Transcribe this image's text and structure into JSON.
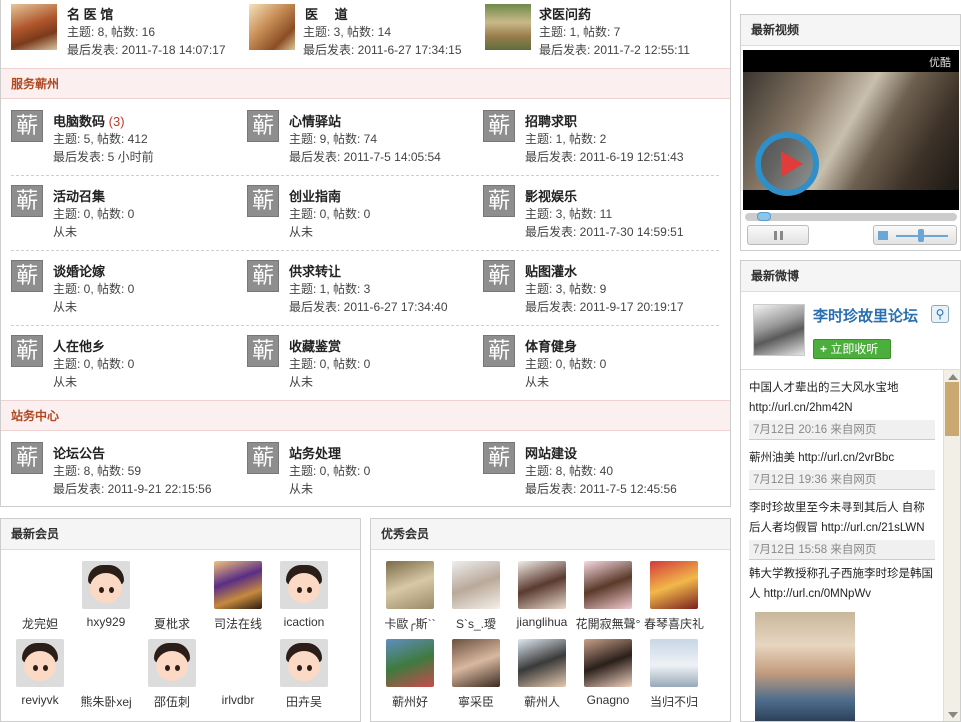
{
  "forums_top": [
    {
      "name": "名 医 馆",
      "stats": "主题: 8, 帖数: 16",
      "last": "最后发表: 2011-7-18 14:07:17"
    },
    {
      "name": "医　 道",
      "stats": "主题: 3, 帖数: 14",
      "last": "最后发表: 2011-6-27 17:34:15"
    },
    {
      "name": "求医问药",
      "stats": "主题: 1, 帖数: 7",
      "last": "最后发表: 2011-7-2 12:55:11"
    }
  ],
  "section1": {
    "title": "服务蕲州"
  },
  "forums_service": [
    {
      "name": "电脑数码",
      "today": "(3)",
      "stats": "主题: 5, 帖数: 412",
      "last": "最后发表: 5 小时前"
    },
    {
      "name": "心情驿站",
      "today": "",
      "stats": "主题: 9, 帖数: 74",
      "last": "最后发表: 2011-7-5 14:05:54"
    },
    {
      "name": "招聘求职",
      "today": "",
      "stats": "主题: 1, 帖数: 2",
      "last": "最后发表: 2011-6-19 12:51:43"
    },
    {
      "name": "活动召集",
      "today": "",
      "stats": "主题: 0, 帖数: 0",
      "last": "从未"
    },
    {
      "name": "创业指南",
      "today": "",
      "stats": "主题: 0, 帖数: 0",
      "last": "从未"
    },
    {
      "name": "影视娱乐",
      "today": "",
      "stats": "主题: 3, 帖数: 11",
      "last": "最后发表: 2011-7-30 14:59:51"
    },
    {
      "name": "谈婚论嫁",
      "today": "",
      "stats": "主题: 0, 帖数: 0",
      "last": "从未"
    },
    {
      "name": "供求转让",
      "today": "",
      "stats": "主题: 1, 帖数: 3",
      "last": "最后发表: 2011-6-27 17:34:40"
    },
    {
      "name": "贴图灌水",
      "today": "",
      "stats": "主题: 3, 帖数: 9",
      "last": "最后发表: 2011-9-17 20:19:17"
    },
    {
      "name": "人在他乡",
      "today": "",
      "stats": "主题: 0, 帖数: 0",
      "last": "从未"
    },
    {
      "name": "收藏鉴赏",
      "today": "",
      "stats": "主题: 0, 帖数: 0",
      "last": "从未"
    },
    {
      "name": "体育健身",
      "today": "",
      "stats": "主题: 0, 帖数: 0",
      "last": "从未"
    }
  ],
  "section2": {
    "title": "站务中心"
  },
  "forums_admin": [
    {
      "name": "论坛公告",
      "stats": "主题: 8, 帖数: 59",
      "last": "最后发表: 2011-9-21 22:15:56"
    },
    {
      "name": "站务处理",
      "stats": "主题: 0, 帖数: 0",
      "last": "从未"
    },
    {
      "name": "网站建设",
      "stats": "主题: 8, 帖数: 40",
      "last": "最后发表: 2011-7-5 12:45:56"
    }
  ],
  "forum_icon_glyph": "蕲",
  "new_members": {
    "title": "最新会员",
    "members": [
      "龙完妲",
      "hxy929",
      "夏枇求",
      "司法在线",
      "icaction",
      "reviyvk",
      "熊朱卧xej",
      "邵伍刺",
      "irlvdbr",
      "田卉吴"
    ]
  },
  "top_members": {
    "title": "优秀会员",
    "members": [
      "卡歐╭斯``",
      "S`s_.璦",
      "jianglihua",
      "花開寂無聲°",
      "春琴喜庆礼",
      "蕲州好",
      "寧采臣",
      "蕲州人",
      "Gnagno",
      "当归不归"
    ]
  },
  "video": {
    "title": "最新视频",
    "brand": "优酷"
  },
  "weibo": {
    "title": "最新微博",
    "account": "李时珍故里论坛",
    "follow_label": "立即收听",
    "posts": [
      {
        "text": "中国人才辈出的三大风水宝地 http://url.cn/2hm42N",
        "meta": "7月12日 20:16 来自网页"
      },
      {
        "text": "蕲州油美 http://url.cn/2vrBbc",
        "meta": "7月12日 19:36 来自网页"
      },
      {
        "text": "李时珍故里至今未寻到其后人 自称后人者均假冒 http://url.cn/21sLWN",
        "meta": "7月12日 15:58 来自网页"
      },
      {
        "text": "韩大学教授称孔子西施李时珍是韩国人 http://url.cn/0MNpWv",
        "meta": ""
      }
    ]
  },
  "colors": {
    "section_text": "#b04820",
    "section_bg": "#fbefef",
    "green_button": "#4cae3c",
    "today_count": "#c0392b"
  }
}
